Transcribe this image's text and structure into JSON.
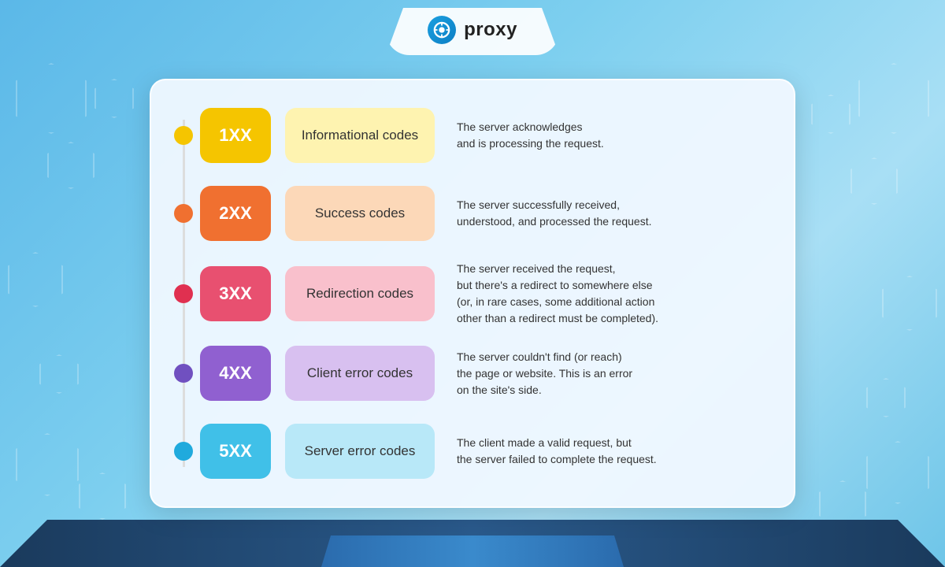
{
  "header": {
    "logo_text": "proxy",
    "logo_icon": "9"
  },
  "rows": [
    {
      "id": "1xx",
      "code": "1XX",
      "label": "Informational codes",
      "description": "The server acknowledges\nand is processing the request.",
      "dot_color": "#f5c500",
      "code_bg": "#f5c500",
      "label_bg": "#fef3b0",
      "color_class": "row-1"
    },
    {
      "id": "2xx",
      "code": "2XX",
      "label": "Success codes",
      "description": "The server successfully received,\nunderstood, and processed the request.",
      "dot_color": "#f07030",
      "code_bg": "#f07030",
      "label_bg": "#fcd8b8",
      "color_class": "row-2"
    },
    {
      "id": "3xx",
      "code": "3XX",
      "label": "Redirection codes",
      "description": "The server received the request,\nbut there's a redirect to somewhere else\n(or, in rare cases, some additional action\nother than a redirect must be completed).",
      "dot_color": "#e03050",
      "code_bg": "#e85070",
      "label_bg": "#f9c0cc",
      "color_class": "row-3"
    },
    {
      "id": "4xx",
      "code": "4XX",
      "label": "Client error codes",
      "description": "The server couldn't find (or reach)\nthe page or website. This is an error\non the site's side.",
      "dot_color": "#7050c0",
      "code_bg": "#9060d0",
      "label_bg": "#d8c0f0",
      "color_class": "row-4"
    },
    {
      "id": "5xx",
      "code": "5XX",
      "label": "Server error codes",
      "description": "The client made a valid request, but\nthe server failed to complete the request.",
      "dot_color": "#20aadd",
      "code_bg": "#40c0e8",
      "label_bg": "#b8e8f8",
      "color_class": "row-5"
    }
  ]
}
